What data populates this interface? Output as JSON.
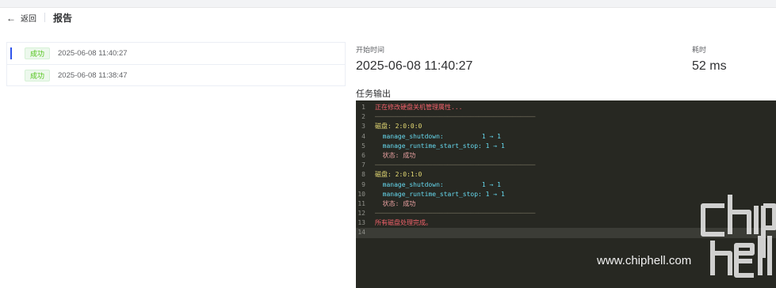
{
  "header": {
    "back_label": "返回",
    "title": "报告"
  },
  "runs": [
    {
      "status": "成功",
      "time": "2025-06-08 11:40:27",
      "active": true
    },
    {
      "status": "成功",
      "time": "2025-06-08 11:38:47",
      "active": false
    }
  ],
  "details": {
    "start_label": "开始时间",
    "start_value": "2025-06-08 11:40:27",
    "duration_label": "耗时",
    "duration_value": "52 ms"
  },
  "output": {
    "title": "任务输出",
    "lines": [
      {
        "n": "1",
        "t": "正在修改硬盘关机管理属性...",
        "c": "c-msg"
      },
      {
        "n": "2",
        "t": "──────────────────────────────────────────",
        "c": "c-sep"
      },
      {
        "n": "3",
        "t": "磁盘: 2:0:0:0",
        "c": "c-disk"
      },
      {
        "n": "4",
        "t": "  manage_shutdown:          1 → 1",
        "c": "c-key"
      },
      {
        "n": "5",
        "t": "  manage_runtime_start_stop: 1 → 1",
        "c": "c-key"
      },
      {
        "n": "6",
        "t": "  状态: 成功",
        "c": "c-state"
      },
      {
        "n": "7",
        "t": "──────────────────────────────────────────",
        "c": "c-sep"
      },
      {
        "n": "8",
        "t": "磁盘: 2:0:1:0",
        "c": "c-disk"
      },
      {
        "n": "9",
        "t": "  manage_shutdown:          1 → 1",
        "c": "c-key"
      },
      {
        "n": "10",
        "t": "  manage_runtime_start_stop: 1 → 1",
        "c": "c-key"
      },
      {
        "n": "11",
        "t": "  状态: 成功",
        "c": "c-state"
      },
      {
        "n": "12",
        "t": "──────────────────────────────────────────",
        "c": "c-sep"
      },
      {
        "n": "13",
        "t": "所有磁盘处理完成。",
        "c": "c-msg"
      },
      {
        "n": "14",
        "t": "",
        "c": ""
      }
    ]
  },
  "watermark": {
    "text": "www.chiphell.com"
  },
  "colors": {
    "accent": "#2f54eb",
    "success": "#52c41a",
    "console_bg": "#272822"
  }
}
